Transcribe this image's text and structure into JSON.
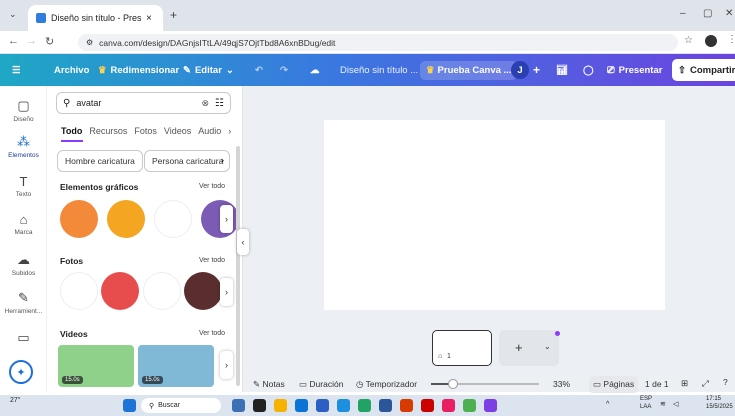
{
  "browser": {
    "tab_title": "Diseño sin título - Presentación",
    "close_tab": "×",
    "new_tab": "+",
    "url": "canva.com/design/DAGnjsITtLA/49qjS7OjtTbd8A6xnBDug/edit",
    "window_min": "–",
    "window_max": "▢",
    "window_close": "✕"
  },
  "toolbar": {
    "menu_icon": "☰",
    "file": "Archivo",
    "resize": "Redimensionar",
    "edit": "Editar",
    "title": "Diseño sin título ...",
    "trial": "Prueba Canva ...",
    "avatar": "J",
    "plus": "+",
    "present": "Presentar",
    "share": "Compartir"
  },
  "rail": [
    {
      "label": "Diseño",
      "icon": "layout-icon"
    },
    {
      "label": "Elementos",
      "icon": "elements-icon"
    },
    {
      "label": "Texto",
      "icon": "text-icon"
    },
    {
      "label": "Marca",
      "icon": "brand-icon"
    },
    {
      "label": "Subidos",
      "icon": "upload-icon"
    },
    {
      "label": "Herramient...",
      "icon": "tools-icon"
    },
    {
      "label": "",
      "icon": "folder-icon"
    }
  ],
  "panel": {
    "search_value": "avatar",
    "tabs": [
      "Todo",
      "Recursos",
      "Fotos",
      "Videos",
      "Audio"
    ],
    "chips": [
      "Hombre caricatura",
      "Persona caricatura"
    ],
    "sections": {
      "graphics": "Elementos gráficos",
      "photos": "Fotos",
      "videos": "Videos",
      "see_all": "Ver todo"
    },
    "video_durations": [
      "15.0s",
      "15.0s"
    ]
  },
  "canvas": {
    "page_number": "1",
    "add": "+"
  },
  "bottom": {
    "notes": "Notas",
    "duration": "Duración",
    "timer": "Temporizador",
    "zoom": "33%",
    "pages": "Páginas",
    "page_count": "1 de 1",
    "zoom_fraction": 0.2
  },
  "taskbar": {
    "temp": "27°",
    "search": "Buscar",
    "lang": "ESP",
    "lang2": "LAA",
    "time": "17:15",
    "date": "15/5/2025"
  },
  "colors": {
    "accent": "#8b3dff",
    "toolbar_start": "#1fa7c5",
    "toolbar_end": "#6b44e0"
  }
}
